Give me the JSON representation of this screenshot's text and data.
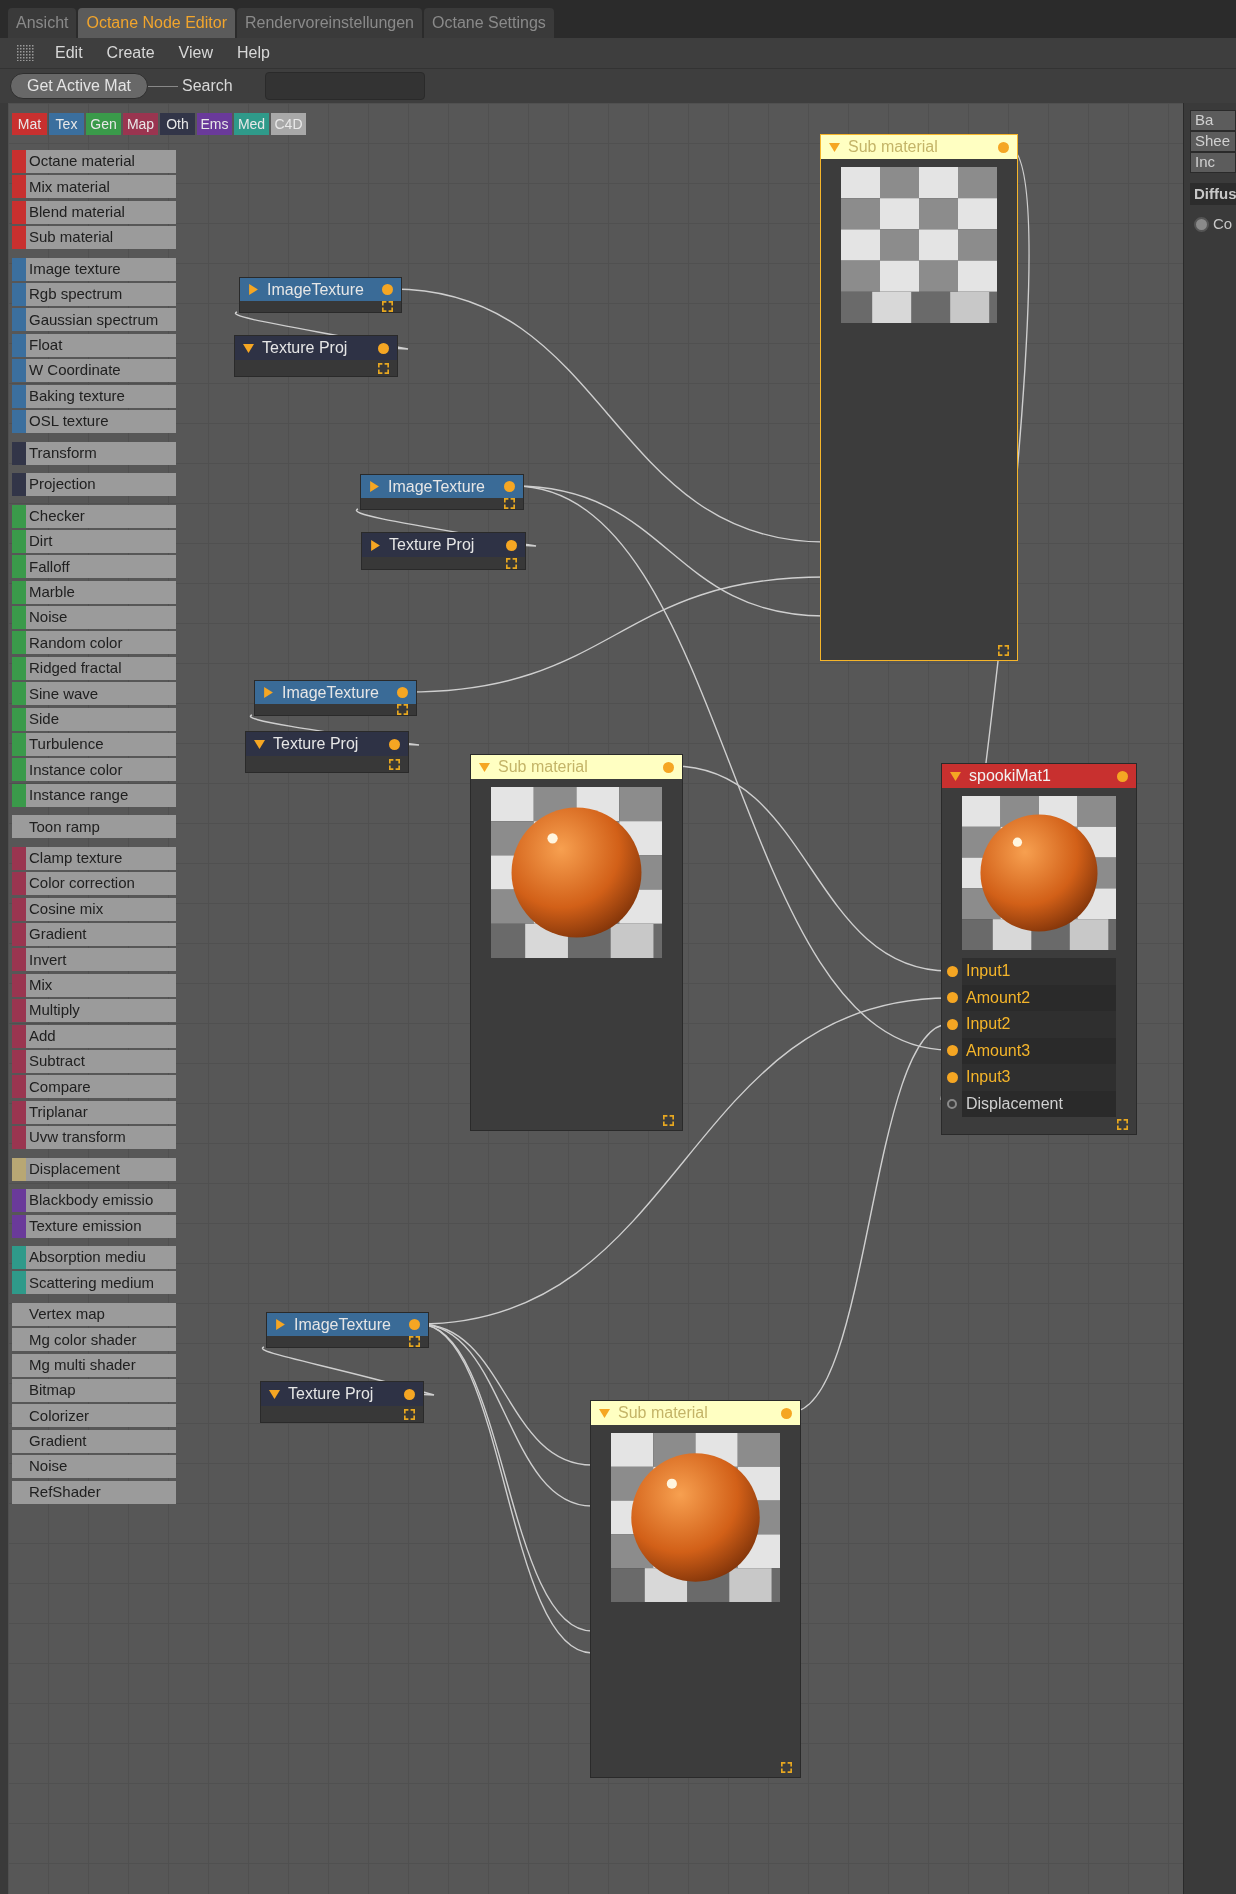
{
  "tabs": [
    {
      "label": "Ansicht",
      "selected": false
    },
    {
      "label": "Octane Node Editor",
      "selected": true
    },
    {
      "label": "Rendervoreinstellungen",
      "selected": false
    },
    {
      "label": "Octane Settings",
      "selected": false
    }
  ],
  "menu": [
    "Edit",
    "Create",
    "View",
    "Help"
  ],
  "toolbar": {
    "button": "Get Active Mat",
    "search_label": "Search"
  },
  "categories": [
    {
      "label": "Mat",
      "color": "#c8302f"
    },
    {
      "label": "Tex",
      "color": "#3b6f9e"
    },
    {
      "label": "Gen",
      "color": "#3a9a4a"
    },
    {
      "label": "Map",
      "color": "#9a3550"
    },
    {
      "label": "Oth",
      "color": "#323548"
    },
    {
      "label": "Ems",
      "color": "#6a3a9a"
    },
    {
      "label": "Med",
      "color": "#2f9a8a"
    },
    {
      "label": "C4D",
      "color": "#a8a8a8"
    }
  ],
  "palette": [
    {
      "color": "#c8302f",
      "items": [
        "Octane material",
        "Mix material",
        "Blend material",
        "Sub material"
      ]
    },
    {
      "color": "#3b6f9e",
      "items": [
        "Image texture",
        "Rgb spectrum",
        "Gaussian spectrum",
        "Float",
        "W Coordinate",
        "Baking texture",
        "OSL texture"
      ]
    },
    {
      "color": "#323548",
      "items": [
        "Transform"
      ]
    },
    {
      "color": "#323548",
      "items": [
        "Projection"
      ]
    },
    {
      "color": "#3a9a4a",
      "items": [
        "Checker",
        "Dirt",
        "Falloff",
        "Marble",
        "Noise",
        "Random color",
        "Ridged fractal",
        "Sine wave",
        "Side",
        "Turbulence",
        "Instance color",
        "Instance range"
      ]
    },
    {
      "items": [
        "Toon ramp"
      ]
    },
    {
      "color": "#9a3550",
      "items": [
        "Clamp texture",
        "Color correction",
        "Cosine mix",
        "Gradient",
        "Invert",
        "Mix",
        "Multiply",
        "Add",
        "Subtract",
        "Compare",
        "Triplanar",
        "Uvw transform"
      ]
    },
    {
      "color": "#b8a774",
      "items": [
        "Displacement"
      ]
    },
    {
      "color": "#6a3a9a",
      "items": [
        "Blackbody emissio",
        "Texture emission"
      ]
    },
    {
      "color": "#2f9a8a",
      "items": [
        "Absorption mediu",
        "Scattering medium"
      ]
    },
    {
      "items": [
        "Vertex map",
        "Mg color shader",
        "Mg multi shader",
        "Bitmap",
        "Colorizer",
        "Gradient",
        "Noise",
        "RefShader"
      ]
    }
  ],
  "nodes": [
    {
      "kind": "image_texture",
      "title": "ImageTexture",
      "expanded": false
    },
    {
      "kind": "texture_projection",
      "title": "Texture Proj",
      "expanded": true
    },
    {
      "kind": "sub_material",
      "title": "Sub material",
      "expanded": true,
      "selected": true,
      "has_sphere": false
    },
    {
      "kind": "image_texture",
      "title": "ImageTexture",
      "expanded": false
    },
    {
      "kind": "texture_projection",
      "title": "Texture Proj",
      "expanded": false
    },
    {
      "kind": "image_texture",
      "title": "ImageTexture",
      "expanded": false
    },
    {
      "kind": "texture_projection",
      "title": "Texture Proj",
      "expanded": true
    },
    {
      "kind": "sub_material",
      "title": "Sub material",
      "expanded": true,
      "selected": false,
      "has_sphere": true
    },
    {
      "kind": "material",
      "title": "spookiMat1",
      "expanded": true,
      "selected": false,
      "has_sphere": true,
      "inputs": [
        {
          "label": "Input1",
          "connected": true
        },
        {
          "label": "Amount2",
          "connected": true
        },
        {
          "label": "Input2",
          "connected": true
        },
        {
          "label": "Amount3",
          "connected": true
        },
        {
          "label": "Input3",
          "connected": true
        },
        {
          "label": "Displacement",
          "connected": false
        }
      ]
    },
    {
      "kind": "image_texture",
      "title": "ImageTexture",
      "expanded": false
    },
    {
      "kind": "texture_projection",
      "title": "Texture Proj",
      "expanded": true
    },
    {
      "kind": "sub_material",
      "title": "Sub material",
      "expanded": true,
      "selected": false,
      "has_sphere": true
    }
  ],
  "right_panel": {
    "buttons": [
      "Ba",
      "Shee",
      "Inc"
    ],
    "section": "Diffus",
    "radio": {
      "label": "Co",
      "selected": false
    }
  }
}
